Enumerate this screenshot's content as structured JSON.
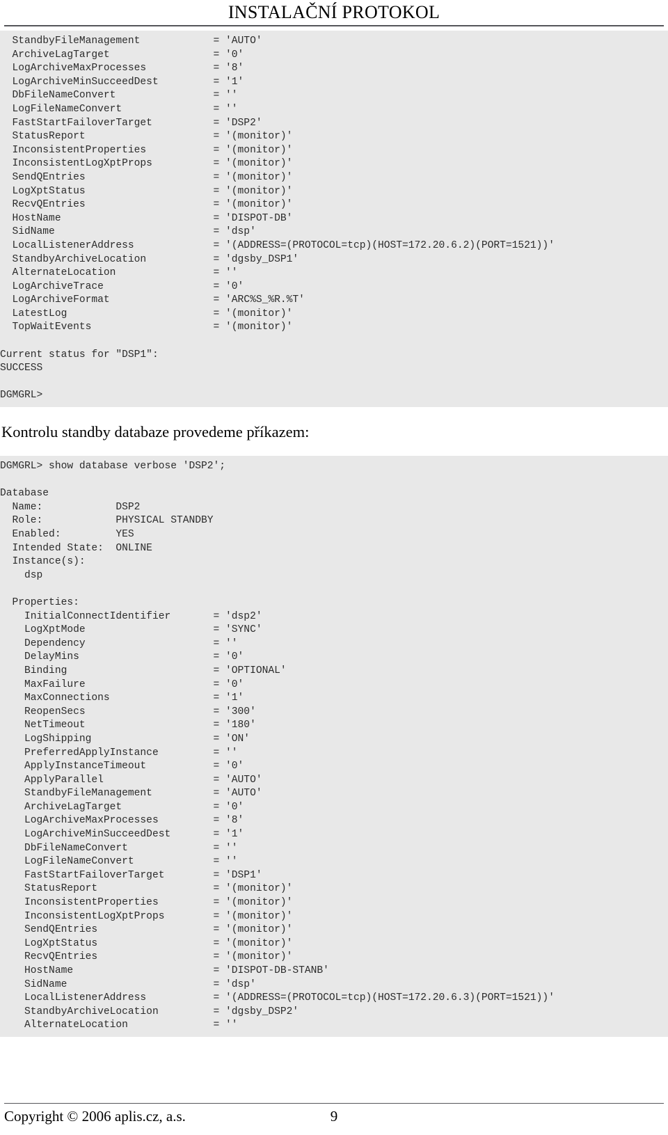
{
  "header": {
    "title": "INSTALAČNÍ PROTOKOL"
  },
  "footer": {
    "copyright": "Copyright © 2006 aplis.cz, a.s.",
    "page_number": "9"
  },
  "colors": {
    "code_background": "#e8e8e8",
    "code_text": "#2b2b2b",
    "rule": "#55565a",
    "page_background": "#ffffff"
  },
  "heading": {
    "text": "Kontrolu standby databaze provedeme příkazem:"
  },
  "code_block_1": {
    "lines": [
      "  StandbyFileManagement            = 'AUTO'",
      "  ArchiveLagTarget                 = '0'",
      "  LogArchiveMaxProcesses           = '8'",
      "  LogArchiveMinSucceedDest         = '1'",
      "  DbFileNameConvert                = ''",
      "  LogFileNameConvert               = ''",
      "  FastStartFailoverTarget          = 'DSP2'",
      "  StatusReport                     = '(monitor)'",
      "  InconsistentProperties           = '(monitor)'",
      "  InconsistentLogXptProps          = '(monitor)'",
      "  SendQEntries                     = '(monitor)'",
      "  LogXptStatus                     = '(monitor)'",
      "  RecvQEntries                     = '(monitor)'",
      "  HostName                         = 'DISPOT-DB'",
      "  SidName                          = 'dsp'",
      "  LocalListenerAddress             = '(ADDRESS=(PROTOCOL=tcp)(HOST=172.20.6.2)(PORT=1521))'",
      "  StandbyArchiveLocation           = 'dgsby_DSP1'",
      "  AlternateLocation                = ''",
      "  LogArchiveTrace                  = '0'",
      "  LogArchiveFormat                 = 'ARC%S_%R.%T'",
      "  LatestLog                        = '(monitor)'",
      "  TopWaitEvents                    = '(monitor)'",
      "",
      "Current status for \"DSP1\":",
      "SUCCESS",
      "",
      "DGMGRL>"
    ]
  },
  "code_block_2": {
    "lines": [
      "DGMGRL> show database verbose 'DSP2';",
      "",
      "Database",
      "  Name:            DSP2",
      "  Role:            PHYSICAL STANDBY",
      "  Enabled:         YES",
      "  Intended State:  ONLINE",
      "  Instance(s):",
      "    dsp",
      "",
      "  Properties:",
      "    InitialConnectIdentifier       = 'dsp2'",
      "    LogXptMode                     = 'SYNC'",
      "    Dependency                     = ''",
      "    DelayMins                      = '0'",
      "    Binding                        = 'OPTIONAL'",
      "    MaxFailure                     = '0'",
      "    MaxConnections                 = '1'",
      "    ReopenSecs                     = '300'",
      "    NetTimeout                     = '180'",
      "    LogShipping                    = 'ON'",
      "    PreferredApplyInstance         = ''",
      "    ApplyInstanceTimeout           = '0'",
      "    ApplyParallel                  = 'AUTO'",
      "    StandbyFileManagement          = 'AUTO'",
      "    ArchiveLagTarget               = '0'",
      "    LogArchiveMaxProcesses         = '8'",
      "    LogArchiveMinSucceedDest       = '1'",
      "    DbFileNameConvert              = ''",
      "    LogFileNameConvert             = ''",
      "    FastStartFailoverTarget        = 'DSP1'",
      "    StatusReport                   = '(monitor)'",
      "    InconsistentProperties         = '(monitor)'",
      "    InconsistentLogXptProps        = '(monitor)'",
      "    SendQEntries                   = '(monitor)'",
      "    LogXptStatus                   = '(monitor)'",
      "    RecvQEntries                   = '(monitor)'",
      "    HostName                       = 'DISPOT-DB-STANB'",
      "    SidName                        = 'dsp'",
      "    LocalListenerAddress           = '(ADDRESS=(PROTOCOL=tcp)(HOST=172.20.6.3)(PORT=1521))'",
      "    StandbyArchiveLocation         = 'dgsby_DSP2'",
      "    AlternateLocation              = ''"
    ]
  }
}
